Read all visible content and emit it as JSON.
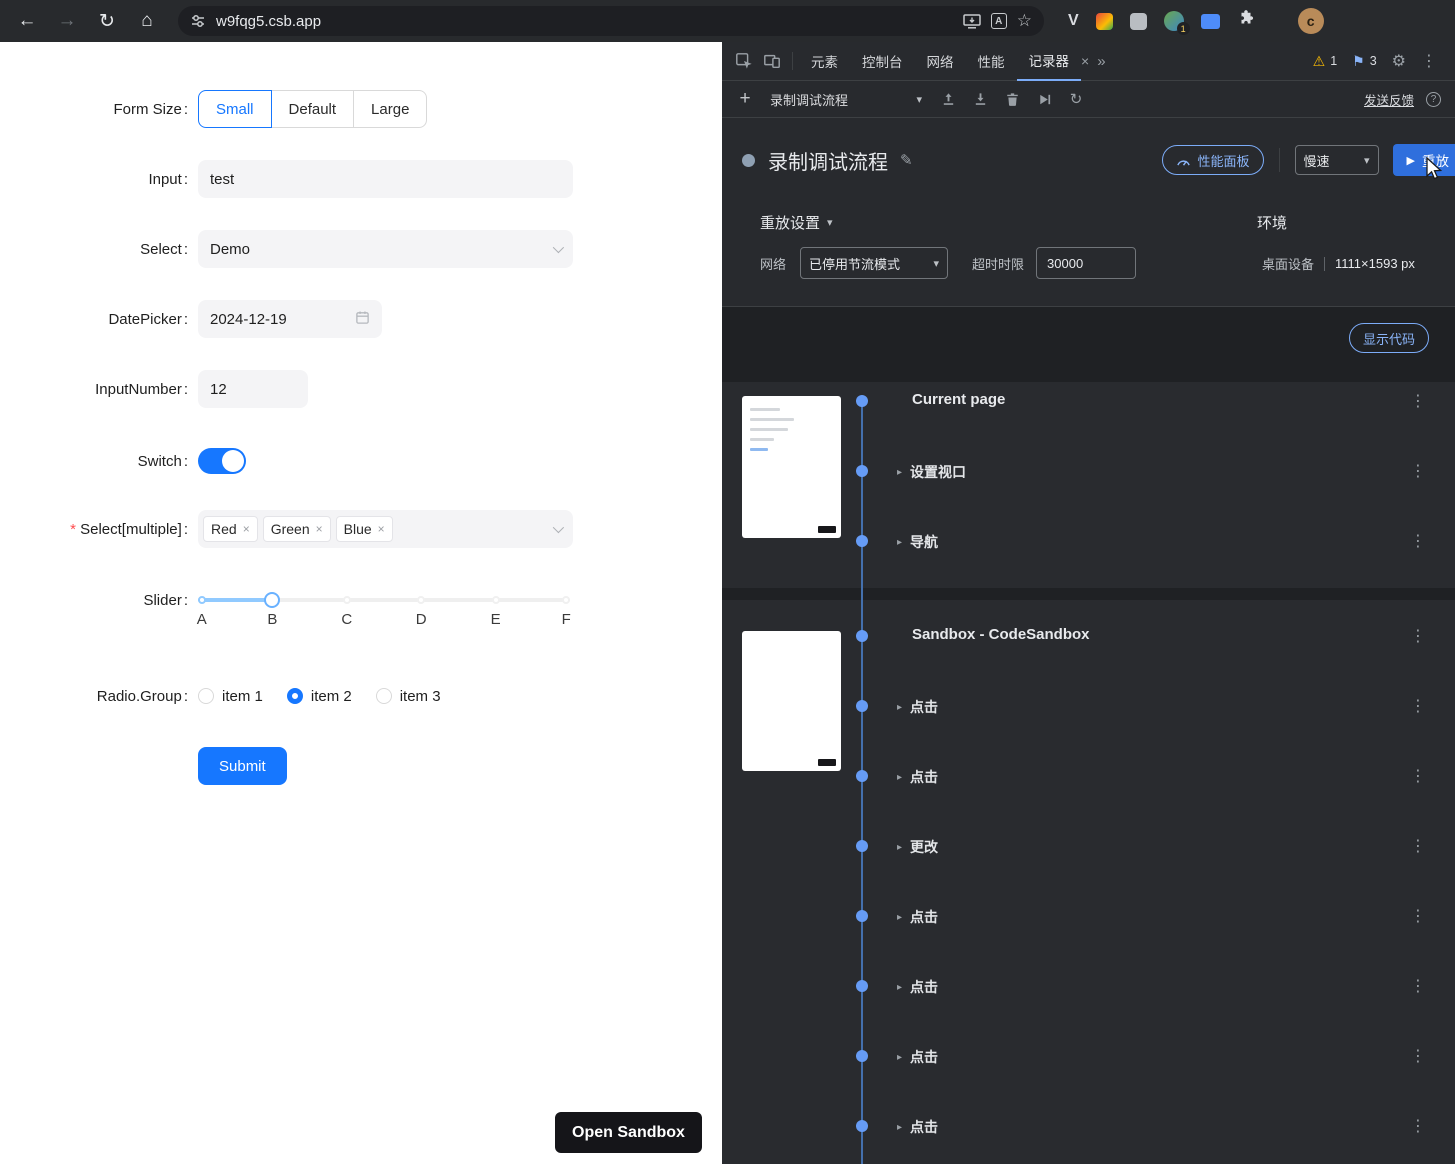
{
  "browser": {
    "url": "w9fqg5.csb.app",
    "profile_initial": "c",
    "extension_badge": "1"
  },
  "icons": {
    "back": "←",
    "forward": "→",
    "reload": "↻",
    "home": "⌂",
    "star": "☆",
    "letter_v": "V",
    "translate_letter": "A",
    "warning": "⚠",
    "flag": "⚑",
    "gear": "⚙",
    "kebab": "⋮",
    "close": "×",
    "more_tabs": "»",
    "plus": "+",
    "chevron_down": "▾",
    "pencil": "✎",
    "play": "▶",
    "rerecord": "↻",
    "step_arrow": "▸",
    "help": "?"
  },
  "form": {
    "size": {
      "label": "Form Size",
      "options": [
        "Small",
        "Default",
        "Large"
      ],
      "selected": "Small"
    },
    "input": {
      "label": "Input",
      "value": "test"
    },
    "select": {
      "label": "Select",
      "value": "Demo"
    },
    "datepicker": {
      "label": "DatePicker",
      "value": "2024-12-19"
    },
    "number": {
      "label": "InputNumber",
      "value": "12"
    },
    "switch": {
      "label": "Switch",
      "on": true
    },
    "multiple": {
      "label": "Select[multiple]",
      "tags": [
        "Red",
        "Green",
        "Blue"
      ]
    },
    "slider": {
      "label": "Slider",
      "marks": [
        "A",
        "B",
        "C",
        "D",
        "E",
        "F"
      ],
      "value_mark": "B"
    },
    "radio": {
      "label": "Radio.Group",
      "options": [
        "item 1",
        "item 2",
        "item 3"
      ],
      "selected": "item 2"
    },
    "submit": "Submit",
    "open_sandbox": "Open Sandbox"
  },
  "devtools": {
    "tabs": [
      "元素",
      "控制台",
      "网络",
      "性能",
      "记录器"
    ],
    "active_tab": "记录器",
    "warning_count": "1",
    "issue_count": "3",
    "toolbar": {
      "recording_name": "录制调试流程",
      "feedback": "发送反馈"
    },
    "header": {
      "title": "录制调试流程",
      "performance": "性能面板",
      "speed": "慢速",
      "replay": "重放"
    },
    "settings": {
      "replay_settings": "重放设置",
      "network": "网络",
      "throttle": "已停用节流模式",
      "timeout_label": "超时时限",
      "timeout_value": "30000",
      "environment": "环境",
      "device": "桌面设备",
      "viewport": "1111×1593 px"
    },
    "show_code": "显示代码",
    "sections": [
      {
        "title": "Current page",
        "steps": [
          "设置视口",
          "导航"
        ]
      },
      {
        "title": "Sandbox - CodeSandbox",
        "steps": [
          "点击",
          "点击",
          "更改",
          "点击",
          "点击",
          "点击",
          "点击"
        ]
      }
    ]
  }
}
